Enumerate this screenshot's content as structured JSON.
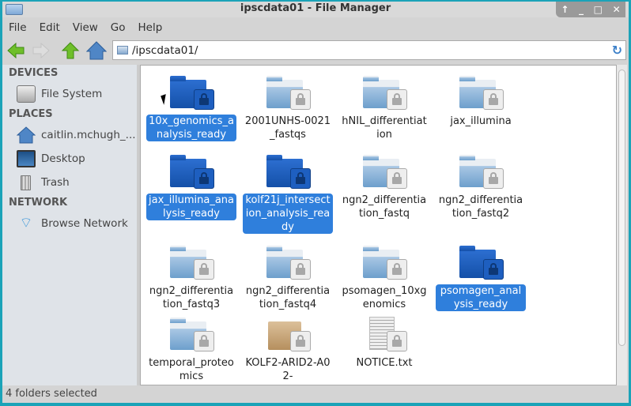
{
  "window": {
    "title": "ipscdata01 - File Manager",
    "controls": [
      "↑",
      "_",
      "□",
      "✕"
    ]
  },
  "menu": [
    "File",
    "Edit",
    "View",
    "Go",
    "Help"
  ],
  "address": "/ipscdata01/",
  "sidebar": {
    "devices_header": "DEVICES",
    "devices": [
      {
        "label": "File System",
        "icon": "drive-icon"
      }
    ],
    "places_header": "PLACES",
    "places": [
      {
        "label": "caitlin.mchugh_...",
        "icon": "home-icon"
      },
      {
        "label": "Desktop",
        "icon": "desktop-icon"
      },
      {
        "label": "Trash",
        "icon": "trash-icon"
      }
    ],
    "network_header": "NETWORK",
    "network": [
      {
        "label": "Browse Network",
        "icon": "wifi-icon"
      }
    ]
  },
  "items": [
    {
      "name": "10x_genomics_analysis_ready",
      "type": "folder",
      "selected": true
    },
    {
      "name": "2001UNHS-0021_fastqs",
      "type": "folder",
      "selected": false
    },
    {
      "name": "hNIL_differentiation",
      "type": "folder",
      "selected": false
    },
    {
      "name": "jax_illumina",
      "type": "folder",
      "selected": false
    },
    {
      "name": "jax_illumina_analysis_ready",
      "type": "folder",
      "selected": true
    },
    {
      "name": "kolf21j_intersection_analysis_ready",
      "type": "folder",
      "selected": true
    },
    {
      "name": "ngn2_differentiation_fastq",
      "type": "folder",
      "selected": false
    },
    {
      "name": "ngn2_differentiation_fastq2",
      "type": "folder",
      "selected": false
    },
    {
      "name": "ngn2_differentiation_fastq3",
      "type": "folder",
      "selected": false
    },
    {
      "name": "ngn2_differentiation_fastq4",
      "type": "folder",
      "selected": false
    },
    {
      "name": "psomagen_10xgenomics",
      "type": "folder",
      "selected": false
    },
    {
      "name": "psomagen_analysis_ready",
      "type": "folder",
      "selected": true
    },
    {
      "name": "temporal_proteomics",
      "type": "folder",
      "selected": false
    },
    {
      "name": "KOLF2-ARID2-A02-",
      "type": "package",
      "selected": false
    },
    {
      "name": "NOTICE.txt",
      "type": "text",
      "selected": false
    }
  ],
  "status": "4 folders selected"
}
